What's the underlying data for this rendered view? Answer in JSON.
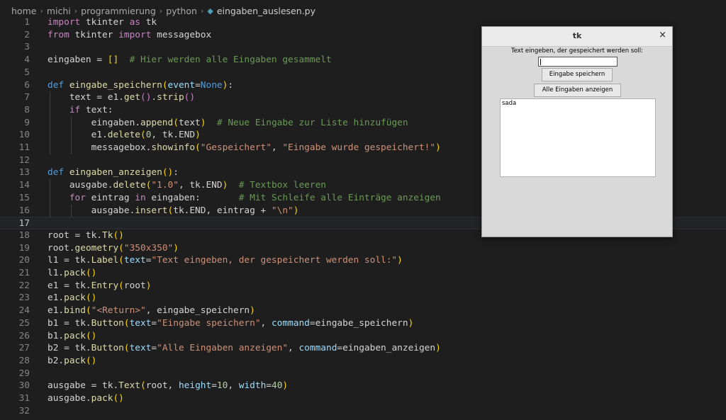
{
  "breadcrumb": {
    "crumbs": [
      "home",
      "michi",
      "programmierung",
      "python"
    ],
    "file": "eingaben_auslesen.py"
  },
  "editor": {
    "active_line": 17,
    "lines": [
      [
        [
          "k",
          "import"
        ],
        [
          "o",
          " tkinter "
        ],
        [
          "k",
          "as"
        ],
        [
          "o",
          " tk"
        ]
      ],
      [
        [
          "k",
          "from"
        ],
        [
          "o",
          " tkinter "
        ],
        [
          "k",
          "import"
        ],
        [
          "o",
          " messagebox"
        ]
      ],
      [],
      [
        [
          "o",
          "eingaben = "
        ],
        [
          "b1",
          "[]"
        ],
        [
          "o",
          "  "
        ],
        [
          "c",
          "# Hier werden alle Eingaben gesammelt"
        ]
      ],
      [],
      [
        [
          "d",
          "def"
        ],
        [
          "o",
          " "
        ],
        [
          "f",
          "eingabe_speichern"
        ],
        [
          "b1",
          "("
        ],
        [
          "p",
          "event"
        ],
        [
          "o",
          "="
        ],
        [
          "d",
          "None"
        ],
        [
          "b1",
          ")"
        ],
        [
          "o",
          ":"
        ]
      ],
      [
        [
          "o",
          "    text = e1."
        ],
        [
          "f",
          "get"
        ],
        [
          "b2",
          "()"
        ],
        [
          "o",
          "."
        ],
        [
          "f",
          "strip"
        ],
        [
          "b2",
          "()"
        ]
      ],
      [
        [
          "o",
          "    "
        ],
        [
          "k",
          "if"
        ],
        [
          "o",
          " text:"
        ]
      ],
      [
        [
          "o",
          "        eingaben."
        ],
        [
          "f",
          "append"
        ],
        [
          "b1",
          "("
        ],
        [
          "o",
          "text"
        ],
        [
          "b1",
          ")"
        ],
        [
          "o",
          "  "
        ],
        [
          "c",
          "# Neue Eingabe zur Liste hinzufügen"
        ]
      ],
      [
        [
          "o",
          "        e1."
        ],
        [
          "f",
          "delete"
        ],
        [
          "b1",
          "("
        ],
        [
          "n",
          "0"
        ],
        [
          "o",
          ", tk.END"
        ],
        [
          "b1",
          ")"
        ]
      ],
      [
        [
          "o",
          "        messagebox."
        ],
        [
          "f",
          "showinfo"
        ],
        [
          "b1",
          "("
        ],
        [
          "s",
          "\"Gespeichert\""
        ],
        [
          "o",
          ", "
        ],
        [
          "s",
          "\"Eingabe wurde gespeichert!\""
        ],
        [
          "b1",
          ")"
        ]
      ],
      [],
      [
        [
          "d",
          "def"
        ],
        [
          "o",
          " "
        ],
        [
          "f",
          "eingaben_anzeigen"
        ],
        [
          "b1",
          "()"
        ],
        [
          "o",
          ":"
        ]
      ],
      [
        [
          "o",
          "    ausgabe."
        ],
        [
          "f",
          "delete"
        ],
        [
          "b1",
          "("
        ],
        [
          "s",
          "\"1.0\""
        ],
        [
          "o",
          ", tk.END"
        ],
        [
          "b1",
          ")"
        ],
        [
          "o",
          "  "
        ],
        [
          "c",
          "# Textbox leeren"
        ]
      ],
      [
        [
          "o",
          "    "
        ],
        [
          "k",
          "for"
        ],
        [
          "o",
          " eintrag "
        ],
        [
          "k",
          "in"
        ],
        [
          "o",
          " eingaben:       "
        ],
        [
          "c",
          "# Mit Schleife alle Einträge anzeigen"
        ]
      ],
      [
        [
          "o",
          "        ausgabe."
        ],
        [
          "f",
          "insert"
        ],
        [
          "b1",
          "("
        ],
        [
          "o",
          "tk.END, eintrag + "
        ],
        [
          "s",
          "\"\\n\""
        ],
        [
          "b1",
          ")"
        ]
      ],
      [],
      [
        [
          "o",
          "root = tk."
        ],
        [
          "f",
          "Tk"
        ],
        [
          "b1",
          "()"
        ]
      ],
      [
        [
          "o",
          "root."
        ],
        [
          "f",
          "geometry"
        ],
        [
          "b1",
          "("
        ],
        [
          "s",
          "\"350x350\""
        ],
        [
          "b1",
          ")"
        ]
      ],
      [
        [
          "o",
          "l1 = tk."
        ],
        [
          "f",
          "Label"
        ],
        [
          "b1",
          "("
        ],
        [
          "p",
          "text"
        ],
        [
          "o",
          "="
        ],
        [
          "s",
          "\"Text eingeben, der gespeichert werden soll:\""
        ],
        [
          "b1",
          ")"
        ]
      ],
      [
        [
          "o",
          "l1."
        ],
        [
          "f",
          "pack"
        ],
        [
          "b1",
          "()"
        ]
      ],
      [
        [
          "o",
          "e1 = tk."
        ],
        [
          "f",
          "Entry"
        ],
        [
          "b1",
          "("
        ],
        [
          "o",
          "root"
        ],
        [
          "b1",
          ")"
        ]
      ],
      [
        [
          "o",
          "e1."
        ],
        [
          "f",
          "pack"
        ],
        [
          "b1",
          "()"
        ]
      ],
      [
        [
          "o",
          "e1."
        ],
        [
          "f",
          "bind"
        ],
        [
          "b1",
          "("
        ],
        [
          "s",
          "\"<Return>\""
        ],
        [
          "o",
          ", eingabe_speichern"
        ],
        [
          "b1",
          ")"
        ]
      ],
      [
        [
          "o",
          "b1 = tk."
        ],
        [
          "f",
          "Button"
        ],
        [
          "b1",
          "("
        ],
        [
          "p",
          "text"
        ],
        [
          "o",
          "="
        ],
        [
          "s",
          "\"Eingabe speichern\""
        ],
        [
          "o",
          ", "
        ],
        [
          "p",
          "command"
        ],
        [
          "o",
          "=eingabe_speichern"
        ],
        [
          "b1",
          ")"
        ]
      ],
      [
        [
          "o",
          "b1."
        ],
        [
          "f",
          "pack"
        ],
        [
          "b1",
          "()"
        ]
      ],
      [
        [
          "o",
          "b2 = tk."
        ],
        [
          "f",
          "Button"
        ],
        [
          "b1",
          "("
        ],
        [
          "p",
          "text"
        ],
        [
          "o",
          "="
        ],
        [
          "s",
          "\"Alle Eingaben anzeigen\""
        ],
        [
          "o",
          ", "
        ],
        [
          "p",
          "command"
        ],
        [
          "o",
          "=eingaben_anzeigen"
        ],
        [
          "b1",
          ")"
        ]
      ],
      [
        [
          "o",
          "b2."
        ],
        [
          "f",
          "pack"
        ],
        [
          "b1",
          "()"
        ]
      ],
      [],
      [
        [
          "o",
          "ausgabe = tk."
        ],
        [
          "f",
          "Text"
        ],
        [
          "b1",
          "("
        ],
        [
          "o",
          "root, "
        ],
        [
          "p",
          "height"
        ],
        [
          "o",
          "="
        ],
        [
          "n",
          "10"
        ],
        [
          "o",
          ", "
        ],
        [
          "p",
          "width"
        ],
        [
          "o",
          "="
        ],
        [
          "n",
          "40"
        ],
        [
          "b1",
          ")"
        ]
      ],
      [
        [
          "o",
          "ausgabe."
        ],
        [
          "f",
          "pack"
        ],
        [
          "b1",
          "()"
        ]
      ],
      []
    ]
  },
  "tk_window": {
    "title": "tk",
    "close_glyph": "×",
    "label": "Text eingeben, der gespeichert werden soll:",
    "entry_value": "",
    "button_save": "Eingabe speichern",
    "button_show": "Alle Eingaben anzeigen",
    "textbox_content": "sada"
  }
}
